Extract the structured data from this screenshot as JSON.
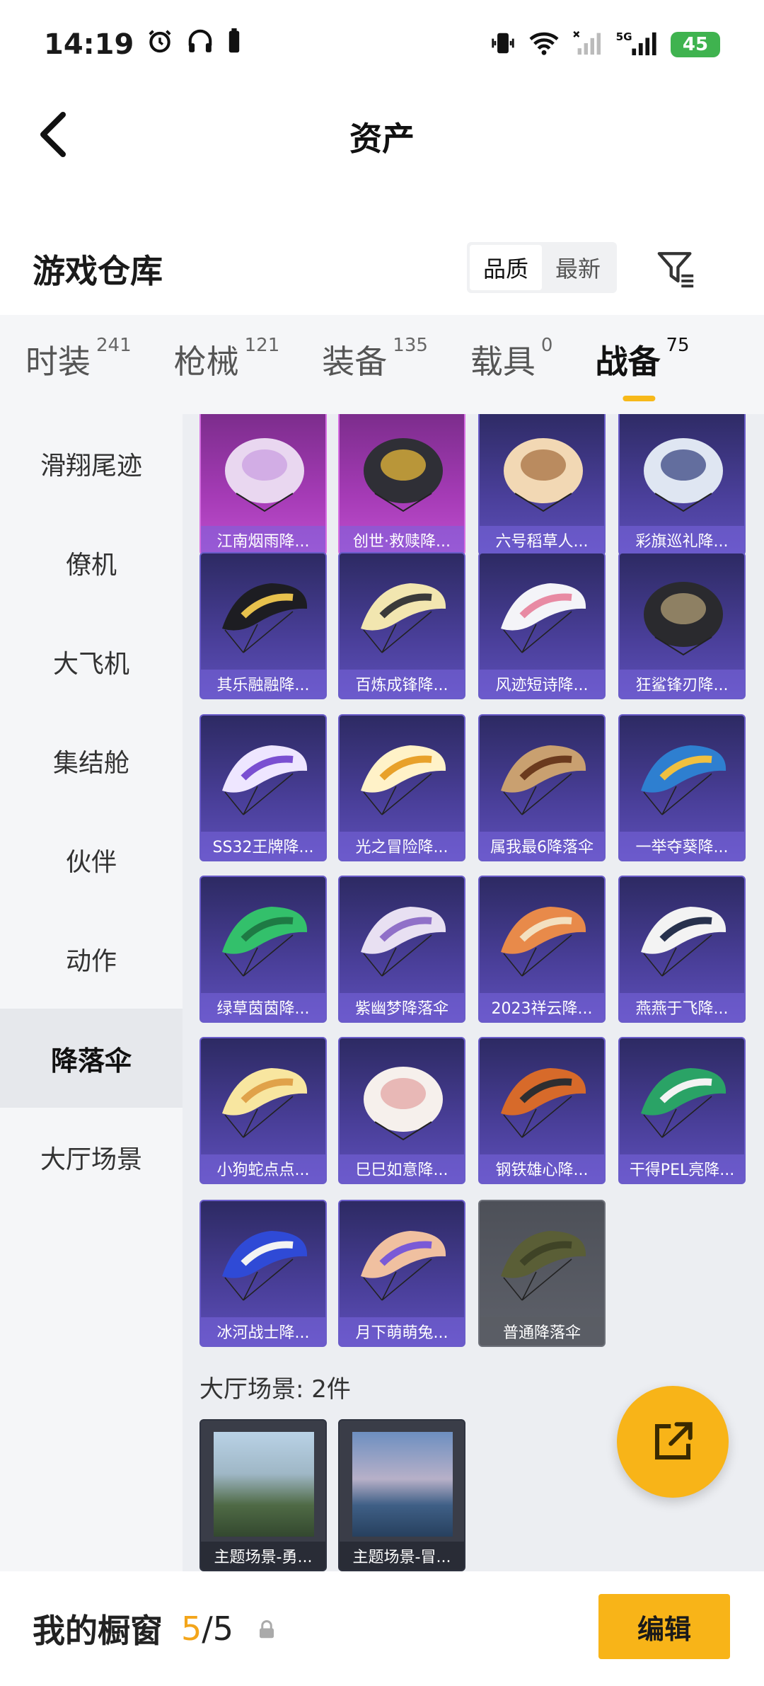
{
  "status_bar": {
    "time": "14:19",
    "battery": "45"
  },
  "header": {
    "title": "资产"
  },
  "warehouse": {
    "title": "游戏仓库",
    "sort_options": [
      "品质",
      "最新"
    ],
    "sort_selected": "品质"
  },
  "tabs": [
    {
      "label": "时装",
      "count": "241",
      "active": false
    },
    {
      "label": "枪械",
      "count": "121",
      "active": false
    },
    {
      "label": "装备",
      "count": "135",
      "active": false
    },
    {
      "label": "载具",
      "count": "0",
      "active": false
    },
    {
      "label": "战备",
      "count": "75",
      "active": true
    }
  ],
  "sidebar": {
    "items": [
      {
        "label": "滑翔尾迹",
        "active": false
      },
      {
        "label": "僚机",
        "active": false
      },
      {
        "label": "大飞机",
        "active": false
      },
      {
        "label": "集结舱",
        "active": false
      },
      {
        "label": "伙伴",
        "active": false
      },
      {
        "label": "动作",
        "active": false
      },
      {
        "label": "降落伞",
        "active": true
      },
      {
        "label": "大厅场景",
        "active": false
      }
    ]
  },
  "items": [
    {
      "name": "江南烟雨降...",
      "rarity": "pink"
    },
    {
      "name": "创世·救赎降...",
      "rarity": "pink"
    },
    {
      "name": "六号稻草人...",
      "rarity": "purple"
    },
    {
      "name": "彩旗巡礼降...",
      "rarity": "purple"
    },
    {
      "name": "其乐融融降...",
      "rarity": "purple"
    },
    {
      "name": "百炼成锋降...",
      "rarity": "purple"
    },
    {
      "name": "风迹短诗降...",
      "rarity": "purple"
    },
    {
      "name": "狂鲨锋刃降...",
      "rarity": "purple"
    },
    {
      "name": "SS32王牌降...",
      "rarity": "purple"
    },
    {
      "name": "光之冒险降...",
      "rarity": "purple"
    },
    {
      "name": "属我最6降落伞",
      "rarity": "purple"
    },
    {
      "name": "一举夺葵降...",
      "rarity": "purple"
    },
    {
      "name": "绿草茵茵降...",
      "rarity": "purple"
    },
    {
      "name": "紫幽梦降落伞",
      "rarity": "purple"
    },
    {
      "name": "2023祥云降...",
      "rarity": "purple"
    },
    {
      "name": "燕燕于飞降...",
      "rarity": "purple"
    },
    {
      "name": "小狗蛇点点...",
      "rarity": "purple"
    },
    {
      "name": "巳巳如意降...",
      "rarity": "purple"
    },
    {
      "name": "钢铁雄心降...",
      "rarity": "purple"
    },
    {
      "name": "干得PEL亮降...",
      "rarity": "purple"
    },
    {
      "name": "冰河战士降...",
      "rarity": "purple"
    },
    {
      "name": "月下萌萌兔...",
      "rarity": "purple"
    },
    {
      "name": "普通降落伞",
      "rarity": "gray"
    }
  ],
  "scene_section": {
    "label": "大厅场景: 2件",
    "items": [
      {
        "name": "主题场景-勇..."
      },
      {
        "name": "主题场景-冒..."
      }
    ]
  },
  "colors": {
    "accent": "#f8b418",
    "purple_card": "#4a3f9a",
    "pink_card": "#a53bb6"
  },
  "bottom": {
    "showcase_label": "我的橱窗",
    "current": "5",
    "total": "/5",
    "edit_label": "编辑"
  }
}
